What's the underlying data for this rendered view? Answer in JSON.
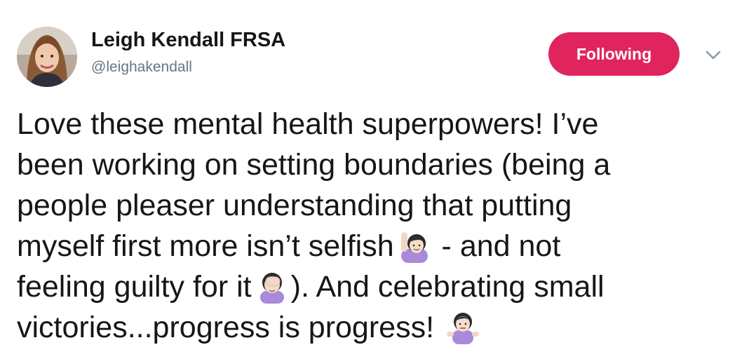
{
  "tweet": {
    "author": {
      "display_name": "Leigh Kendall FRSA",
      "handle": "@leighakendall",
      "avatar_icon": "profile-photo"
    },
    "follow_button_label": "Following",
    "follow_button_color": "#e0245e",
    "menu_icon": "chevron-down-icon",
    "text_lines": [
      [
        "Love these mental health superpowers! I’ve"
      ],
      [
        "been working on setting boundaries (being a"
      ],
      [
        "people pleaser understanding that putting"
      ],
      [
        "myself first more isn’t selfish",
        " - and not"
      ],
      [
        "feeling guilty for it",
        "). And celebrating small"
      ],
      [
        "victories...progress is progress!",
        ""
      ]
    ],
    "emojis": [
      "woman-raising-hand-emoji",
      "woman-facepalming-emoji",
      "woman-shrugging-emoji"
    ]
  }
}
